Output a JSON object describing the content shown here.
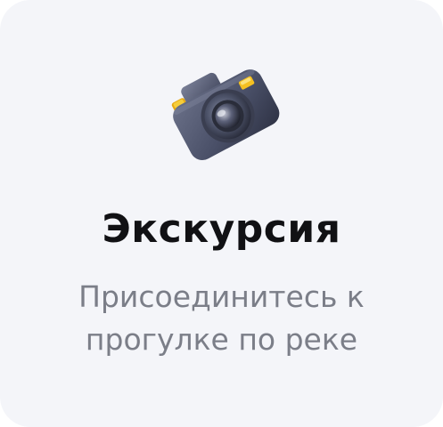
{
  "card": {
    "icon": "camera-icon",
    "title": "Экскурсия",
    "subtitle_line1": "Присоединитесь к",
    "subtitle_line2": "прогулке по реке"
  },
  "colors": {
    "background": "#f4f5f9",
    "title": "#111114",
    "subtitle": "#7b7e88",
    "camera_body": "#4a5068",
    "camera_accent": "#f2c01e"
  }
}
